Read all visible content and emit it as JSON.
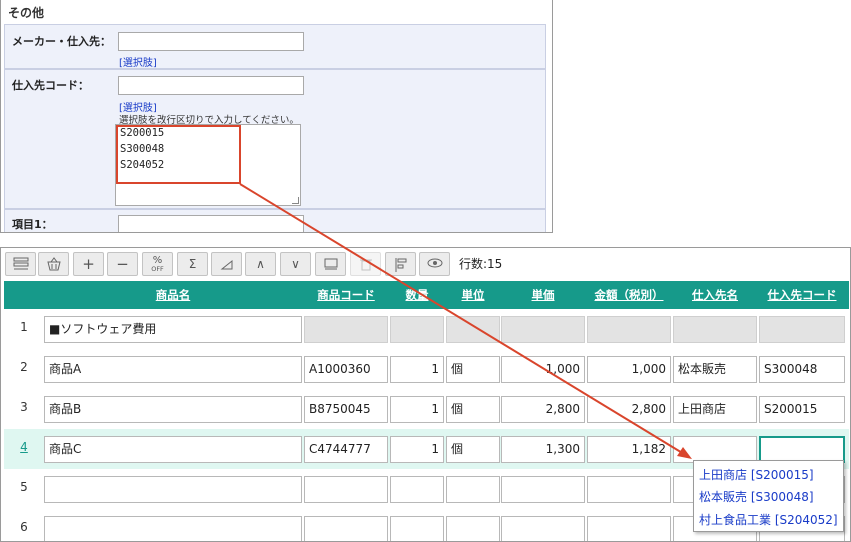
{
  "form": {
    "section_title": "その他",
    "fields": [
      {
        "label": "メーカー・仕入先：",
        "value": "",
        "link": "[選択肢]"
      },
      {
        "label": "仕入先コード：",
        "value": "",
        "link": "[選択肢]",
        "hint": "選択肢を改行区切りで入力してください。",
        "options": [
          "S200015",
          "S300048",
          "S204052"
        ]
      },
      {
        "label": "項目1：",
        "value": ""
      }
    ]
  },
  "toolbar": {
    "buttons": [
      "menu-icon",
      "basket-icon",
      "+",
      "−",
      "%",
      "Σ",
      "corner-icon",
      "∧",
      "∨",
      "window-icon",
      "trash-icon",
      "tree-icon",
      "eye-icon"
    ],
    "pct_sub": "OFF",
    "row_count": "行数:15"
  },
  "grid": {
    "columns": [
      "商品名",
      "商品コード",
      "数量",
      "単位",
      "単価",
      "金額（税別）",
      "仕入先名",
      "仕入先コード"
    ],
    "rows": [
      {
        "no": "1",
        "name": "■ソフトウェア費用",
        "code": "",
        "qty": "",
        "unit": "",
        "price": "",
        "amount": "",
        "supplier": "",
        "supplier_code": ""
      },
      {
        "no": "2",
        "name": "商品A",
        "code": "A1000360",
        "qty": "1",
        "unit": "個",
        "price": "1,000",
        "amount": "1,000",
        "supplier": "松本販売",
        "supplier_code": "S300048"
      },
      {
        "no": "3",
        "name": "商品B",
        "code": "B8750045",
        "qty": "1",
        "unit": "個",
        "price": "2,800",
        "amount": "2,800",
        "supplier": "上田商店",
        "supplier_code": "S200015"
      },
      {
        "no": "4",
        "name": "商品C",
        "code": "C4744777",
        "qty": "1",
        "unit": "個",
        "price": "1,300",
        "amount": "1,182",
        "supplier": "",
        "supplier_code": ""
      },
      {
        "no": "5",
        "name": "",
        "code": "",
        "qty": "",
        "unit": "",
        "price": "",
        "amount": "",
        "supplier": "",
        "supplier_code": ""
      },
      {
        "no": "6",
        "name": "",
        "code": "",
        "qty": "",
        "unit": "",
        "price": "",
        "amount": "",
        "supplier": "",
        "supplier_code": ""
      }
    ]
  },
  "dropdown": {
    "items": [
      "上田商店 [S200015]",
      "松本販売 [S300048]",
      "村上食品工業 [S204052]"
    ]
  },
  "colors": {
    "header": "#169a8a",
    "accent_red": "#d9452c",
    "link": "#1a3cc8"
  }
}
